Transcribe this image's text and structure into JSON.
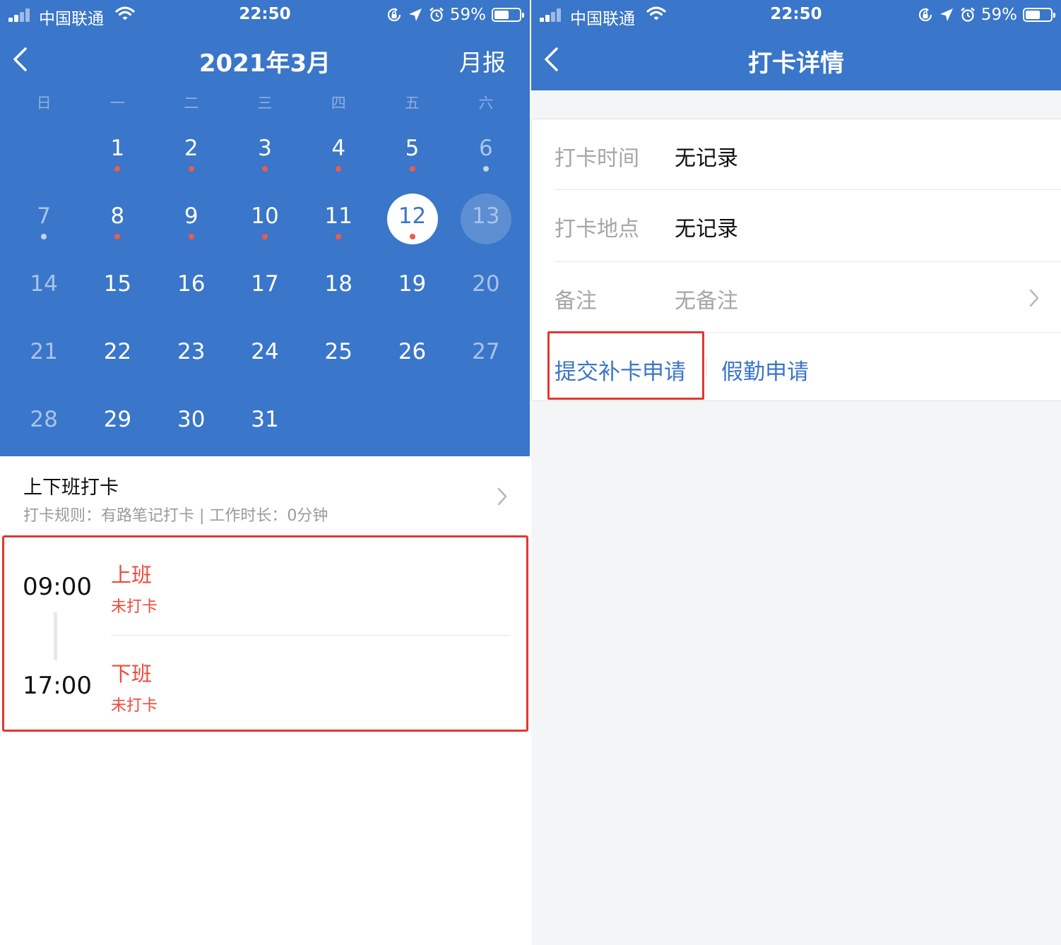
{
  "status_bar": {
    "carrier": "中国联通",
    "time": "22:50",
    "battery": "59%",
    "battery_level": 0.59
  },
  "left_screen": {
    "nav": {
      "back_icon": "chevron-left-icon",
      "title": "2021年3月",
      "right_action": "月报"
    },
    "weekdays": [
      "日",
      "一",
      "二",
      "三",
      "四",
      "五",
      "六"
    ],
    "calendar": {
      "selected_day": 12,
      "today": 13,
      "weeks": [
        [
          null,
          {
            "day": "1",
            "dot": "red"
          },
          {
            "day": "2",
            "dot": "red"
          },
          {
            "day": "3",
            "dot": "red"
          },
          {
            "day": "4",
            "dot": "red"
          },
          {
            "day": "5",
            "dot": "red"
          },
          {
            "day": "6",
            "dot": "grey",
            "muted": true
          }
        ],
        [
          {
            "day": "7",
            "dot": "grey",
            "muted": true
          },
          {
            "day": "8",
            "dot": "red"
          },
          {
            "day": "9",
            "dot": "red"
          },
          {
            "day": "10",
            "dot": "red"
          },
          {
            "day": "11",
            "dot": "red"
          },
          {
            "day": "12",
            "dot": "red",
            "selected": true
          },
          {
            "day": "13",
            "today": true,
            "muted": true
          }
        ],
        [
          {
            "day": "14",
            "muted": true
          },
          {
            "day": "15"
          },
          {
            "day": "16"
          },
          {
            "day": "17"
          },
          {
            "day": "18"
          },
          {
            "day": "19"
          },
          {
            "day": "20",
            "muted": true
          }
        ],
        [
          {
            "day": "21",
            "muted": true
          },
          {
            "day": "22"
          },
          {
            "day": "23"
          },
          {
            "day": "24"
          },
          {
            "day": "25"
          },
          {
            "day": "26"
          },
          {
            "day": "27",
            "muted": true
          }
        ],
        [
          {
            "day": "28",
            "muted": true
          },
          {
            "day": "29"
          },
          {
            "day": "30"
          },
          {
            "day": "31"
          },
          null,
          null,
          null
        ]
      ]
    },
    "shift": {
      "title": "上下班打卡",
      "subtitle": "打卡规则：有路笔记打卡 | 工作时长：0分钟"
    },
    "records": [
      {
        "time": "09:00",
        "label": "上班",
        "status": "未打卡"
      },
      {
        "time": "17:00",
        "label": "下班",
        "status": "未打卡"
      }
    ]
  },
  "right_screen": {
    "nav": {
      "back_icon": "chevron-left-icon",
      "title": "打卡详情"
    },
    "rows": [
      {
        "label": "打卡时间",
        "value": "无记录"
      },
      {
        "label": "打卡地点",
        "value": "无记录"
      },
      {
        "label": "备注",
        "value": "无备注"
      }
    ],
    "actions": {
      "makeup": "提交补卡申请",
      "leave": "假勤申请"
    }
  },
  "colors": {
    "primary_blue": "#3a76c9",
    "alert_red": "#ee4a3b",
    "highlight_red": "#e2372f"
  }
}
